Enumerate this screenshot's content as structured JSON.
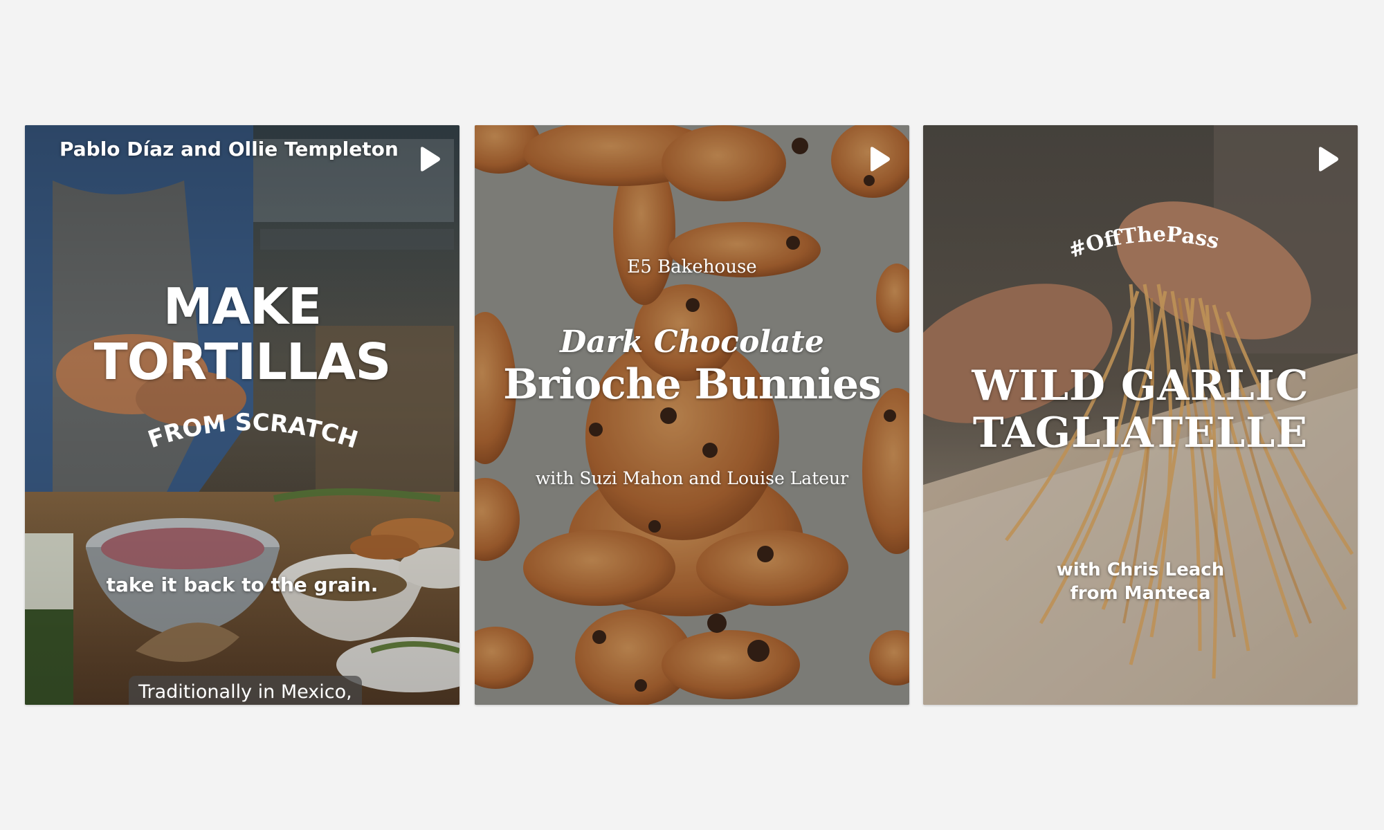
{
  "cards": [
    {
      "creator": "Pablo Díaz and Ollie Templeton",
      "title_line1": "MAKE",
      "title_line2": "TORTILLAS",
      "subtitle": "FROM SCRATCH",
      "tagline": "take it back to the grain.",
      "caption": "Traditionally in Mexico,",
      "play_icon": "play-icon"
    },
    {
      "bakery": "E5 Bakehouse",
      "title_line1": "Dark Chocolate",
      "title_line2": "Brioche Bunnies",
      "with_line": "with Suzi Mahon and Louise Lateur",
      "play_icon": "play-icon"
    },
    {
      "hashtag": "#OffThePass",
      "title_line1": "WILD GARLIC",
      "title_line2": "TAGLIATELLE",
      "with_line": "with Chris Leach",
      "from_line": "from Manteca",
      "play_icon": "play-icon"
    }
  ],
  "colors": {
    "page_background": "#f3f3f3",
    "overlay_text": "#ffffff"
  }
}
